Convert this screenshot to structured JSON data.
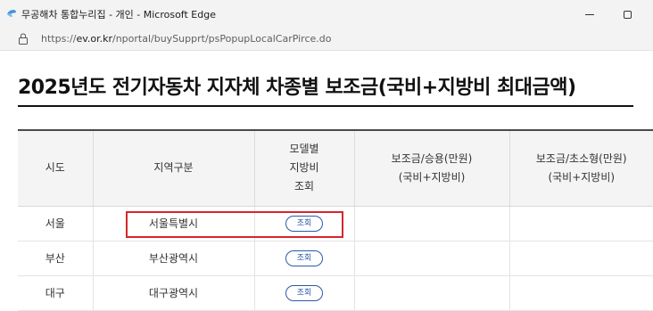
{
  "window": {
    "title": "무공해차 통합누리집 - 개인 - Microsoft Edge",
    "url_prefix": "https://",
    "url_domain": "ev.or.kr",
    "url_path": "/nportal/buySupprt/psPopupLocalCarPirce.do"
  },
  "page": {
    "title": "2025년도 전기자동차 지자체 차종별 보조금(국비+지방비 최대금액)"
  },
  "table": {
    "headers": {
      "region": "시도",
      "area": "지역구분",
      "model_line1": "모델별",
      "model_line2": "지방비",
      "model_line3": "조회",
      "passenger_line1": "보조금/승용(만원)",
      "passenger_line2": "(국비+지방비)",
      "small_line1": "보조금/초소형(만원)",
      "small_line2": "(국비+지방비)"
    },
    "rows": [
      {
        "region": "서울",
        "area": "서울특별시",
        "button": "조회"
      },
      {
        "region": "부산",
        "area": "부산광역시",
        "button": "조회"
      },
      {
        "region": "대구",
        "area": "대구광역시",
        "button": "조회"
      }
    ]
  },
  "colors": {
    "highlight": "#d6262b",
    "button": "#2b5aa8"
  },
  "icons": {
    "app": "edge-app-icon",
    "lock": "lock-icon",
    "minimize": "minimize-icon",
    "maximize": "maximize-icon"
  }
}
